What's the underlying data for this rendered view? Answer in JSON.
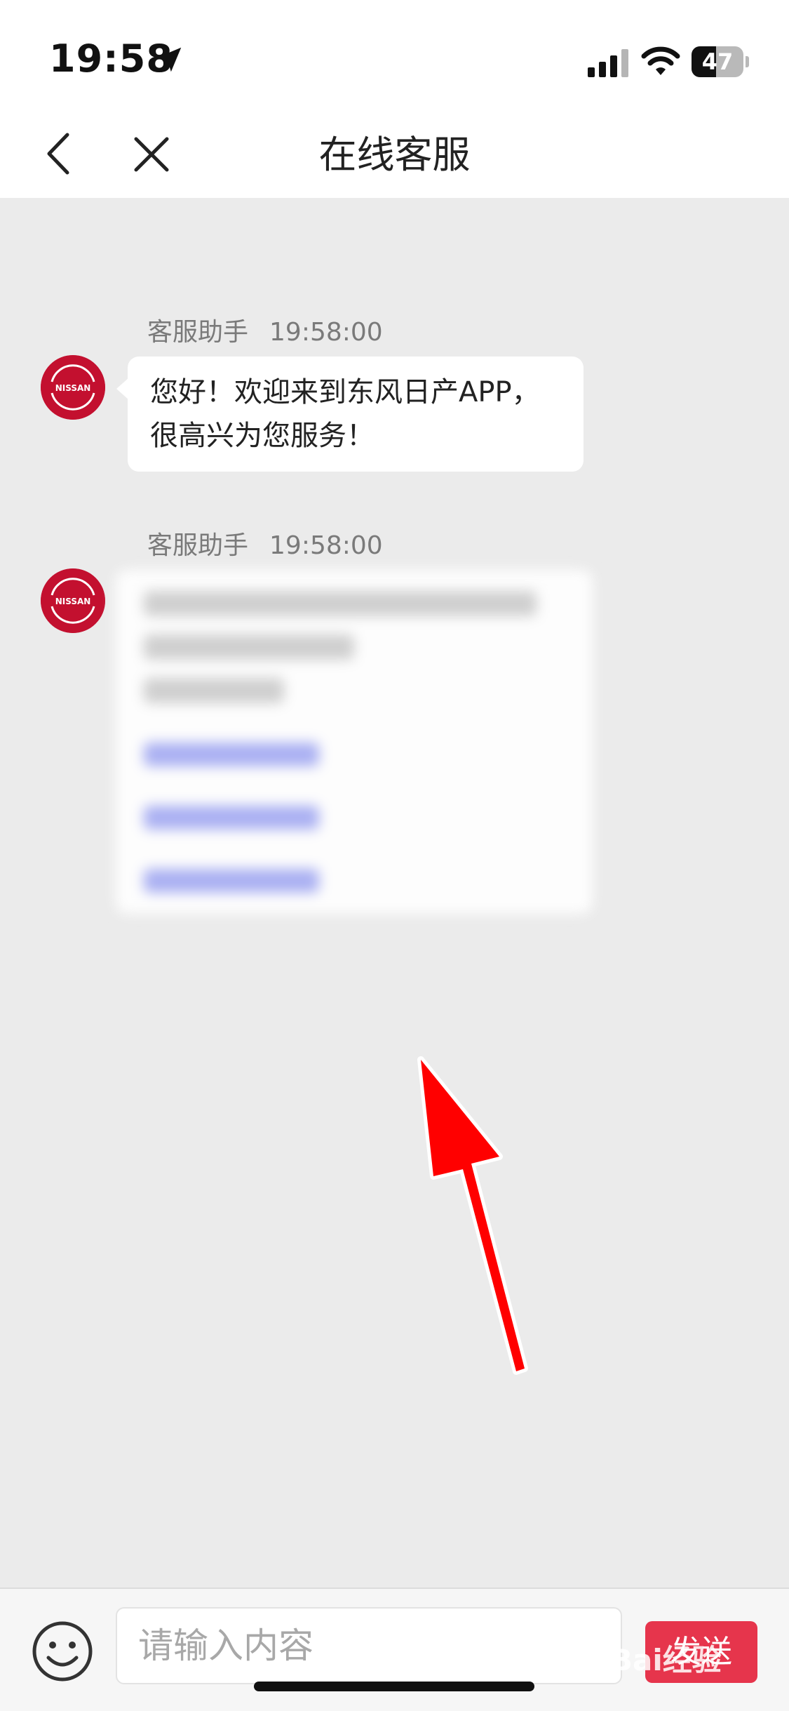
{
  "status_bar": {
    "time": "19:58",
    "battery_level": "47",
    "icons": [
      "location-arrow-icon",
      "cellular-signal-icon",
      "wifi-icon",
      "battery-icon"
    ]
  },
  "nav": {
    "title": "在线客服",
    "back_icon": "chevron-left-icon",
    "close_icon": "close-icon"
  },
  "messages": [
    {
      "sender": "客服助手",
      "time": "19:58:00",
      "avatar_icon": "nissan-logo-icon",
      "avatar_text": "NISSAN",
      "text": "您好！欢迎来到东风日产APP，很高兴为您服务！"
    },
    {
      "sender": "客服助手",
      "time": "19:58:00",
      "avatar_icon": "nissan-logo-icon",
      "avatar_text": "NISSAN",
      "blurred": true
    }
  ],
  "annotation": {
    "arrow_color": "#ff0000"
  },
  "input_bar": {
    "emoji_icon": "smiley-icon",
    "placeholder": "请输入内容",
    "send_label": "发送",
    "send_color": "#e6354c"
  },
  "watermark": "Bai经验"
}
